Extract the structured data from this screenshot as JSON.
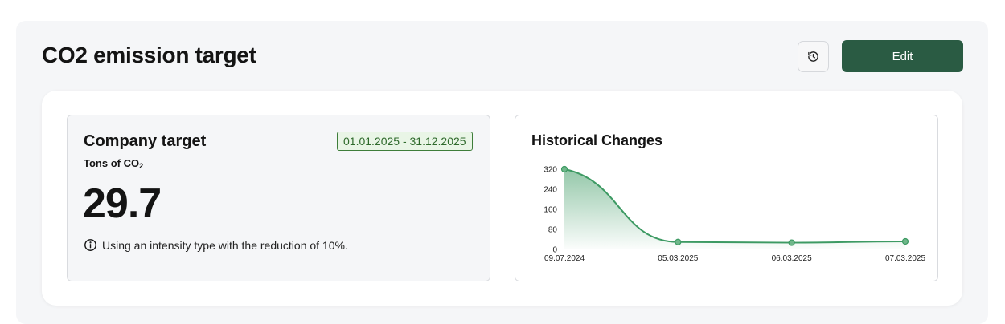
{
  "header": {
    "title": "CO2 emission target",
    "edit_label": "Edit",
    "history_icon": "history-icon"
  },
  "target_card": {
    "title": "Company target",
    "date_range": "01.01.2025 - 31.12.2025",
    "unit_prefix": "Tons of CO",
    "unit_sub": "2",
    "value": "29.7",
    "info_icon": "info-icon",
    "info_text": "Using an intensity type with the reduction of 10%."
  },
  "history_card": {
    "title": "Historical Changes"
  },
  "colors": {
    "accent": "#2a5b43",
    "line": "#3d9a63",
    "badge_bg": "#e9f5e6",
    "badge_border": "#3e7d3a"
  },
  "chart_data": {
    "type": "area",
    "title": "Historical Changes",
    "categories": [
      "09.07.2024",
      "05.03.2025",
      "06.03.2025",
      "07.03.2025"
    ],
    "values": [
      320,
      29.7,
      27,
      32
    ],
    "y_ticks": [
      0,
      80,
      160,
      240,
      320
    ],
    "ylim": [
      0,
      320
    ],
    "grid": false,
    "legend": "none"
  }
}
